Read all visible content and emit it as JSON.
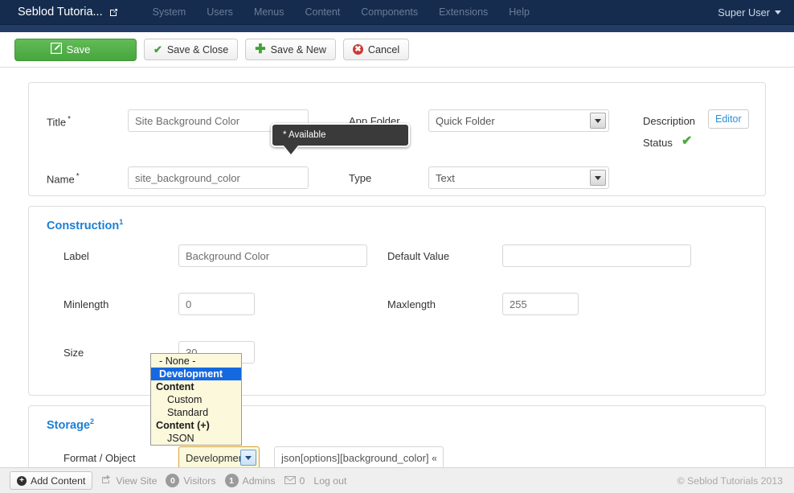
{
  "topbar": {
    "brand": "Seblod Tutoria...",
    "brand_icon": "external-link-icon",
    "menu": [
      {
        "label": "System"
      },
      {
        "label": "Users"
      },
      {
        "label": "Menus"
      },
      {
        "label": "Content"
      },
      {
        "label": "Components"
      },
      {
        "label": "Extensions"
      },
      {
        "label": "Help"
      }
    ],
    "user": "Super User",
    "user_caret_icon": "chevron-down-icon",
    "bg_color": "#152c4e"
  },
  "toolbar": {
    "save_label": "Save",
    "save_icon": "pencil-square-icon",
    "save_close_label": "Save & Close",
    "save_close_icon": "check-icon",
    "save_new_label": "Save & New",
    "save_new_icon": "plus-icon",
    "cancel_label": "Cancel",
    "cancel_icon": "cancel-circle-icon",
    "save_bg_color": "#4fae45"
  },
  "identity": {
    "title_label": "Title",
    "title_required": "*",
    "title_value": "Site Background Color",
    "name_label": "Name",
    "name_required": "*",
    "name_value": "site_background_color",
    "app_folder_label": "App Folder",
    "app_folder_value": "Quick Folder",
    "type_label": "Type",
    "type_value": "Text",
    "description_label": "Description",
    "editor_button": "Editor",
    "status_label": "Status",
    "status_icon": "check-icon",
    "status_color": "#4fa83d"
  },
  "tooltip": {
    "text": "* Available",
    "bg_color": "#3a3a3a"
  },
  "construction": {
    "section_title": "Construction",
    "section_sup": "1",
    "label_label": "Label",
    "label_value": "Background Color",
    "default_value_label": "Default Value",
    "default_value_value": "",
    "minlength_label": "Minlength",
    "minlength_value": "0",
    "maxlength_label": "Maxlength",
    "maxlength_value": "255",
    "size_label": "Size",
    "size_value": "30"
  },
  "storage": {
    "section_title": "Storage",
    "section_sup": "2",
    "format_object_label": "Format / Object",
    "format_value": "Development",
    "object_value": "json[options][background_color] «"
  },
  "dropdown": {
    "open": true,
    "selected": "Development",
    "options": [
      {
        "label": "- None -",
        "type": "option"
      },
      {
        "label": "Development",
        "type": "option",
        "selected": true
      },
      {
        "label": "Content",
        "type": "group"
      },
      {
        "label": "Custom",
        "type": "option",
        "indent": true
      },
      {
        "label": "Standard",
        "type": "option",
        "indent": true
      },
      {
        "label": "Content (+)",
        "type": "group"
      },
      {
        "label": "JSON",
        "type": "option",
        "indent": true
      }
    ],
    "bg_color": "#fbf8dc",
    "selected_color": "#1569e0"
  },
  "footer": {
    "add_content_label": "Add Content",
    "add_content_icon": "plus-circle-icon",
    "view_site_label": "View Site",
    "view_site_icon": "share-icon",
    "visitors_count": "0",
    "visitors_label": "Visitors",
    "admins_count": "1",
    "admins_label": "Admins",
    "messages_icon": "envelope-icon",
    "messages_count": "0",
    "logout_label": "Log out",
    "copyright": "© Seblod Tutorials 2013"
  }
}
